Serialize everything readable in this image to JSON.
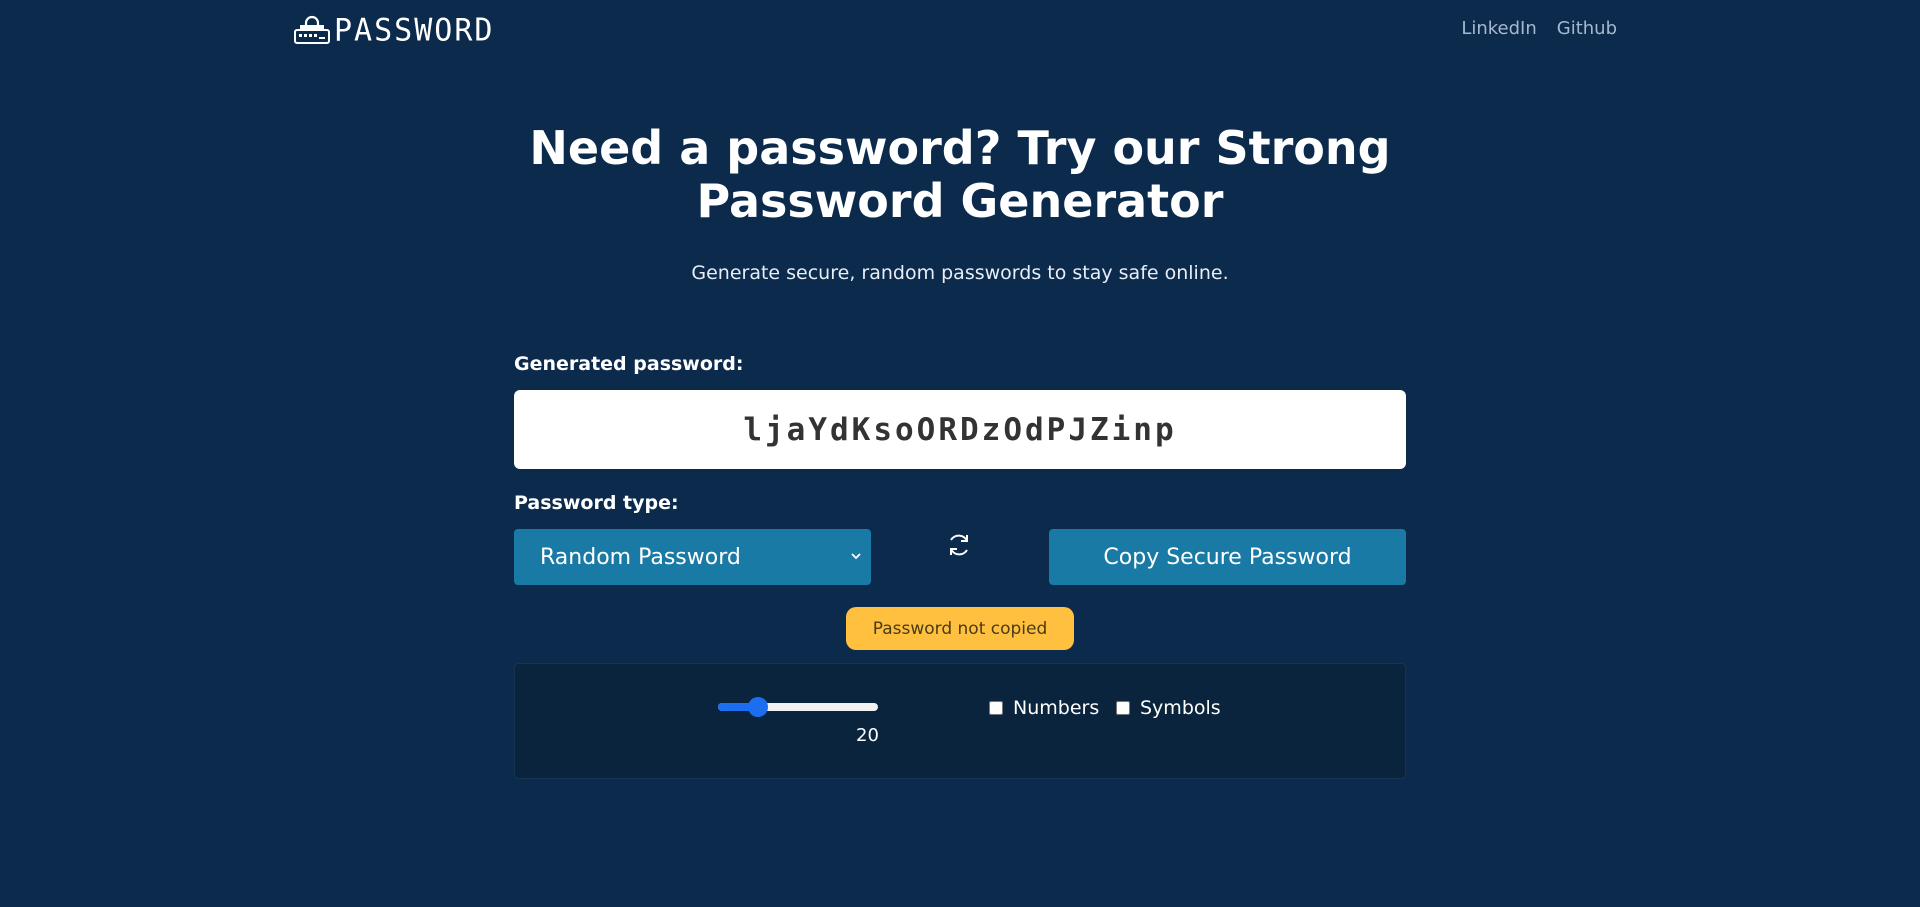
{
  "nav": {
    "logo_text": "PASSWORD",
    "links": [
      "LinkedIn",
      "Github"
    ]
  },
  "hero": {
    "title_line1": "Need a password? Try our Strong",
    "title_line2": "Password Generator",
    "subtitle": "Generate secure, random passwords to stay safe online."
  },
  "generator": {
    "generated_label": "Generated password:",
    "password": "ljaYdKsoORDzOdPJZinp",
    "type_label": "Password type:",
    "type_selected": "Random Password",
    "copy_button": "Copy Secure Password",
    "copy_status": "Password not copied"
  },
  "options": {
    "length": 20,
    "length_min": 8,
    "length_max": 64,
    "numbers_label": "Numbers",
    "numbers_checked": false,
    "symbols_label": "Symbols",
    "symbols_checked": false
  },
  "colors": {
    "background": "#0b2a4c",
    "button": "#1a7aa6",
    "badge": "#fec03e",
    "slider": "#1c6ef0"
  },
  "icons": {
    "logo": "lock-keyboard-icon",
    "refresh": "refresh-icon",
    "select": "chevron-down-icon"
  }
}
